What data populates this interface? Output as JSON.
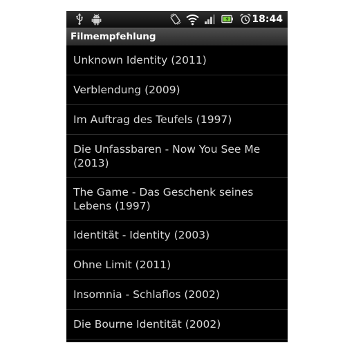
{
  "status_bar": {
    "time": "18:44",
    "icons": [
      "usb-icon",
      "android-debug-icon",
      "rotation-icon",
      "wifi-icon",
      "signal-icon",
      "battery-icon",
      "alarm-icon"
    ]
  },
  "title": "Filmempfehlung",
  "movies": [
    "Unknown Identity (2011)",
    "Verblendung (2009)",
    "Im Auftrag des Teufels (1997)",
    "Die Unfassbaren - Now You See Me (2013)",
    "The Game - Das Geschenk seines Lebens (1997)",
    "Identität - Identity (2003)",
    "Ohne Limit (2011)",
    "Insomnia - Schlaflos (2002)",
    "Die Bourne Identität (2002)"
  ],
  "colors": {
    "background": "#000000",
    "text": "#d9d9d9",
    "divider": "#2b2b2b"
  }
}
